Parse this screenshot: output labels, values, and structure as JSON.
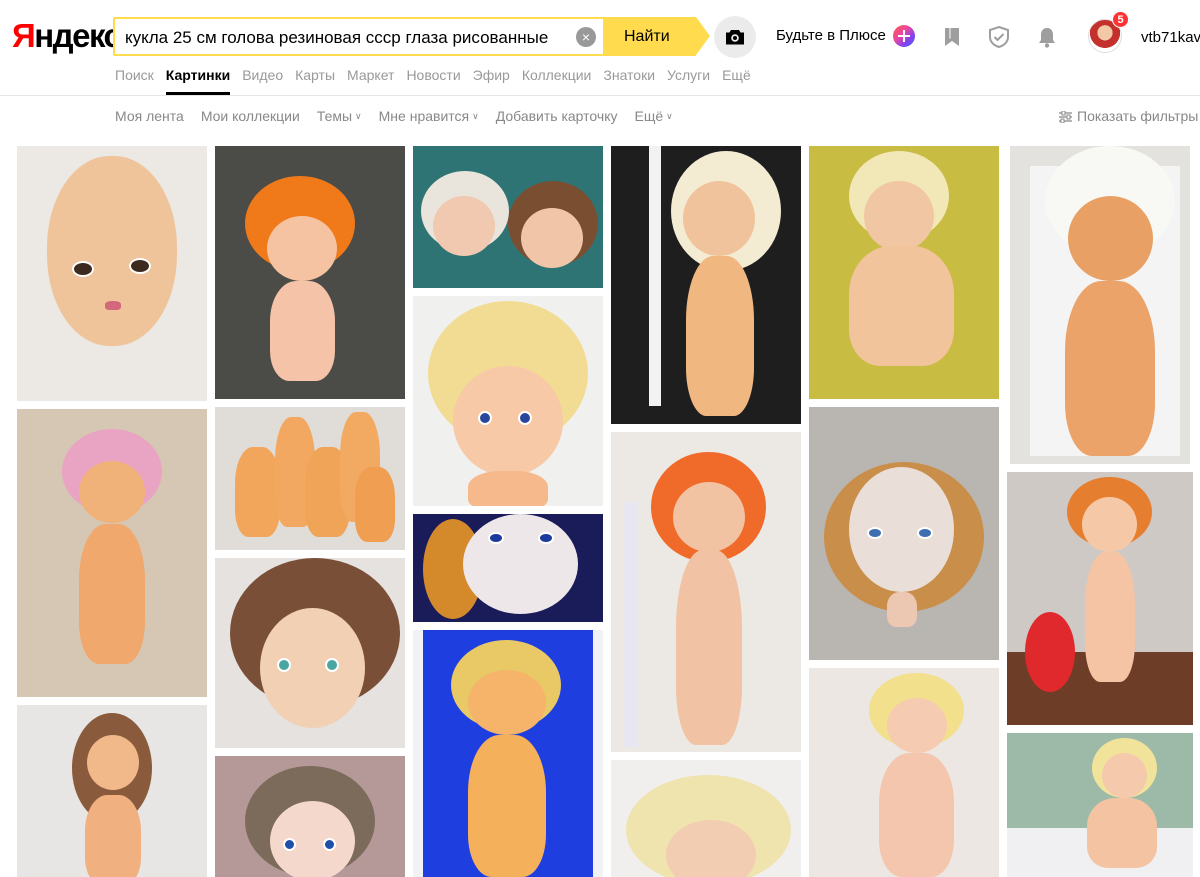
{
  "logo": {
    "first": "Я",
    "rest": "ндекс"
  },
  "search": {
    "query": "кукла 25 см голова резиновая ссср глаза рисованные",
    "clear_icon": "×",
    "button": "Найти"
  },
  "header": {
    "plus_text": "Будьте в Плюсе",
    "notifications_count": "5",
    "username": "vtb71kav"
  },
  "nav": {
    "tabs": [
      "Поиск",
      "Картинки",
      "Видео",
      "Карты",
      "Маркет",
      "Новости",
      "Эфир",
      "Коллекции",
      "Знатоки",
      "Услуги",
      "Ещё"
    ],
    "active": "Картинки"
  },
  "subnav": {
    "items": [
      "Моя лента",
      "Мои коллекции",
      "Темы",
      "Мне нравится",
      "Добавить карточку",
      "Ещё"
    ],
    "dropdown_items": [
      "Темы",
      "Мне нравится",
      "Ещё"
    ],
    "filters": "Показать фильтры"
  },
  "icons": {
    "camera": "camera-icon",
    "bookmark": "bookmark-icon",
    "shield": "shield-icon",
    "bell": "bell-icon",
    "filters": "sliders-icon"
  },
  "colors": {
    "brand_red": "#ff0000",
    "accent_yellow": "#ffdb4d",
    "muted_text": "#999999"
  }
}
